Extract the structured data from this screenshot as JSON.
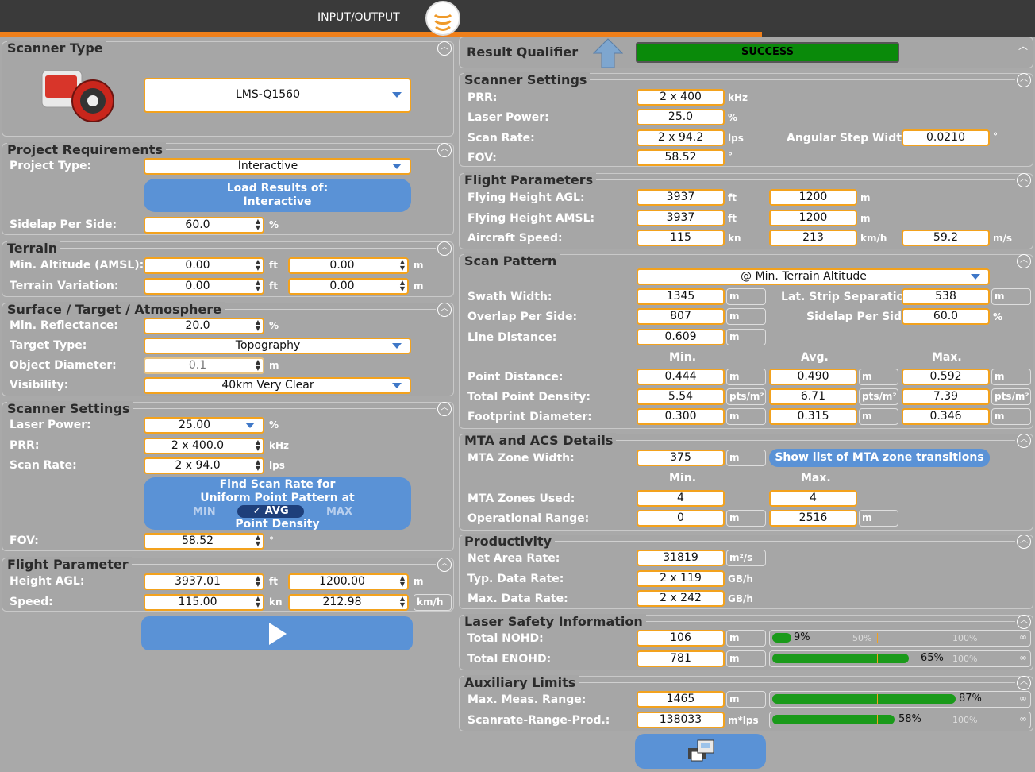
{
  "header": {
    "title": "INPUT/OUTPUT"
  },
  "left": {
    "scanner_type": {
      "title": "Scanner Type",
      "model": "LMS-Q1560"
    },
    "project": {
      "title": "Project Requirements",
      "type_label": "Project Type:",
      "type": "Interactive",
      "load_btn_line1": "Load Results of:",
      "load_btn_line2": "Interactive",
      "sidelap_label": "Sidelap Per Side:",
      "sidelap": "60.0",
      "sidelap_unit": "%"
    },
    "terrain": {
      "title": "Terrain",
      "min_alt_label": "Min. Altitude (AMSL):",
      "min_alt_ft": "0.00",
      "min_alt_m": "0.00",
      "var_label": "Terrain Variation:",
      "var_ft": "0.00",
      "var_m": "0.00",
      "ft": "ft",
      "m": "m"
    },
    "surface": {
      "title": "Surface / Target / Atmosphere",
      "refl_label": "Min. Reflectance:",
      "refl": "20.0",
      "refl_unit": "%",
      "target_label": "Target Type:",
      "target": "Topography",
      "obj_label": "Object Diameter:",
      "obj": "0.1",
      "obj_unit": "m",
      "vis_label": "Visibility:",
      "vis": "40km Very Clear"
    },
    "scanner": {
      "title": "Scanner Settings",
      "power_label": "Laser Power:",
      "power": "25.00",
      "power_unit": "%",
      "prr_label": "PRR:",
      "prr": "2 x 400.0",
      "prr_unit": "kHz",
      "rate_label": "Scan Rate:",
      "rate": "2 x 94.0",
      "rate_unit": "lps",
      "find_line1": "Find Scan Rate for",
      "find_line2": "Uniform Point Pattern at",
      "find_min": "MIN",
      "find_avg": "✓ AVG",
      "find_max": "MAX",
      "find_line4": "Point Density",
      "fov_label": "FOV:",
      "fov": "58.52",
      "fov_unit": "°"
    },
    "flight": {
      "title": "Flight Parameter",
      "agl_label": "Height AGL:",
      "agl_ft": "3937.01",
      "agl_m": "1200.00",
      "speed_label": "Speed:",
      "speed_kn": "115.00",
      "speed_kmh": "212.98",
      "ft": "ft",
      "m": "m",
      "kn": "kn",
      "kmh": "km/h"
    }
  },
  "right": {
    "result": {
      "label": "Result Qualifier",
      "status": "SUCCESS",
      "status_color": "#0a8a0a"
    },
    "scanner": {
      "title": "Scanner Settings",
      "prr_label": "PRR:",
      "prr": "2 x 400",
      "prr_unit": "kHz",
      "power_label": "Laser Power:",
      "power": "25.0",
      "power_unit": "%",
      "rate_label": "Scan Rate:",
      "rate": "2 x 94.2",
      "rate_unit": "lps",
      "asw_label": "Angular Step Width:",
      "asw": "0.0210",
      "asw_unit": "°",
      "fov_label": "FOV:",
      "fov": "58.52",
      "fov_unit": "°"
    },
    "flight": {
      "title": "Flight Parameters",
      "agl_label": "Flying Height AGL:",
      "agl_ft": "3937",
      "agl_m": "1200",
      "amsl_label": "Flying Height AMSL:",
      "amsl_ft": "3937",
      "amsl_m": "1200",
      "speed_label": "Aircraft Speed:",
      "speed_kn": "115",
      "speed_kmh": "213",
      "speed_ms": "59.2",
      "ft": "ft",
      "m": "m",
      "kn": "kn",
      "kmh": "km/h",
      "ms": "m/s"
    },
    "pattern": {
      "title": "Scan Pattern",
      "mode": "@ Min. Terrain Altitude",
      "swath_label": "Swath Width:",
      "swath": "1345",
      "lat_label": "Lat. Strip Separation:",
      "lat": "538",
      "overlap_label": "Overlap Per Side:",
      "overlap": "807",
      "sidelap_label": "Sidelap Per Side:",
      "sidelap": "60.0",
      "line_label": "Line Distance:",
      "line": "0.609",
      "h_min": "Min.",
      "h_avg": "Avg.",
      "h_max": "Max.",
      "pd_label": "Point Distance:",
      "pd_min": "0.444",
      "pd_avg": "0.490",
      "pd_max": "0.592",
      "tpd_label": "Total Point Density:",
      "tpd_min": "5.54",
      "tpd_avg": "6.71",
      "tpd_max": "7.39",
      "fd_label": "Footprint Diameter:",
      "fd_min": "0.300",
      "fd_avg": "0.315",
      "fd_max": "0.346",
      "m": "m",
      "pct": "%",
      "density_unit": "pts/m²"
    },
    "mta": {
      "title": "MTA and ACS Details",
      "zone_label": "MTA Zone Width:",
      "zone": "375",
      "show_btn": "Show list of MTA zone transitions",
      "h_min": "Min.",
      "h_max": "Max.",
      "used_label": "MTA Zones Used:",
      "used_min": "4",
      "used_max": "4",
      "op_label": "Operational Range:",
      "op_min": "0",
      "op_max": "2516",
      "m": "m"
    },
    "prod": {
      "title": "Productivity",
      "net_label": "Net Area Rate:",
      "net": "31819",
      "net_unit": "m²/s",
      "typ_label": "Typ. Data Rate:",
      "typ": "2 x 119",
      "typ_unit": "GB/h",
      "max_label": "Max. Data Rate:",
      "max": "2 x 242",
      "max_unit": "GB/h"
    },
    "laser": {
      "title": "Laser Safety Information",
      "nohd_label": "Total NOHD:",
      "nohd": "106",
      "nohd_pct": "9%",
      "nohd_frac": 0.09,
      "enohd_label": "Total ENOHD:",
      "enohd": "781",
      "enohd_pct": "65%",
      "enohd_frac": 0.65,
      "m": "m",
      "m50": "50%",
      "m100": "100%",
      "inf": "∞"
    },
    "aux": {
      "title": "Auxiliary Limits",
      "meas_label": "Max. Meas. Range:",
      "meas": "1465",
      "meas_pct": "87%",
      "meas_frac": 0.87,
      "srp_label": "Scanrate-Range-Prod.:",
      "srp": "138033",
      "srp_pct": "58%",
      "srp_frac": 0.58,
      "m": "m",
      "srp_unit": "m*lps",
      "m100": "100%",
      "inf": "∞"
    }
  }
}
